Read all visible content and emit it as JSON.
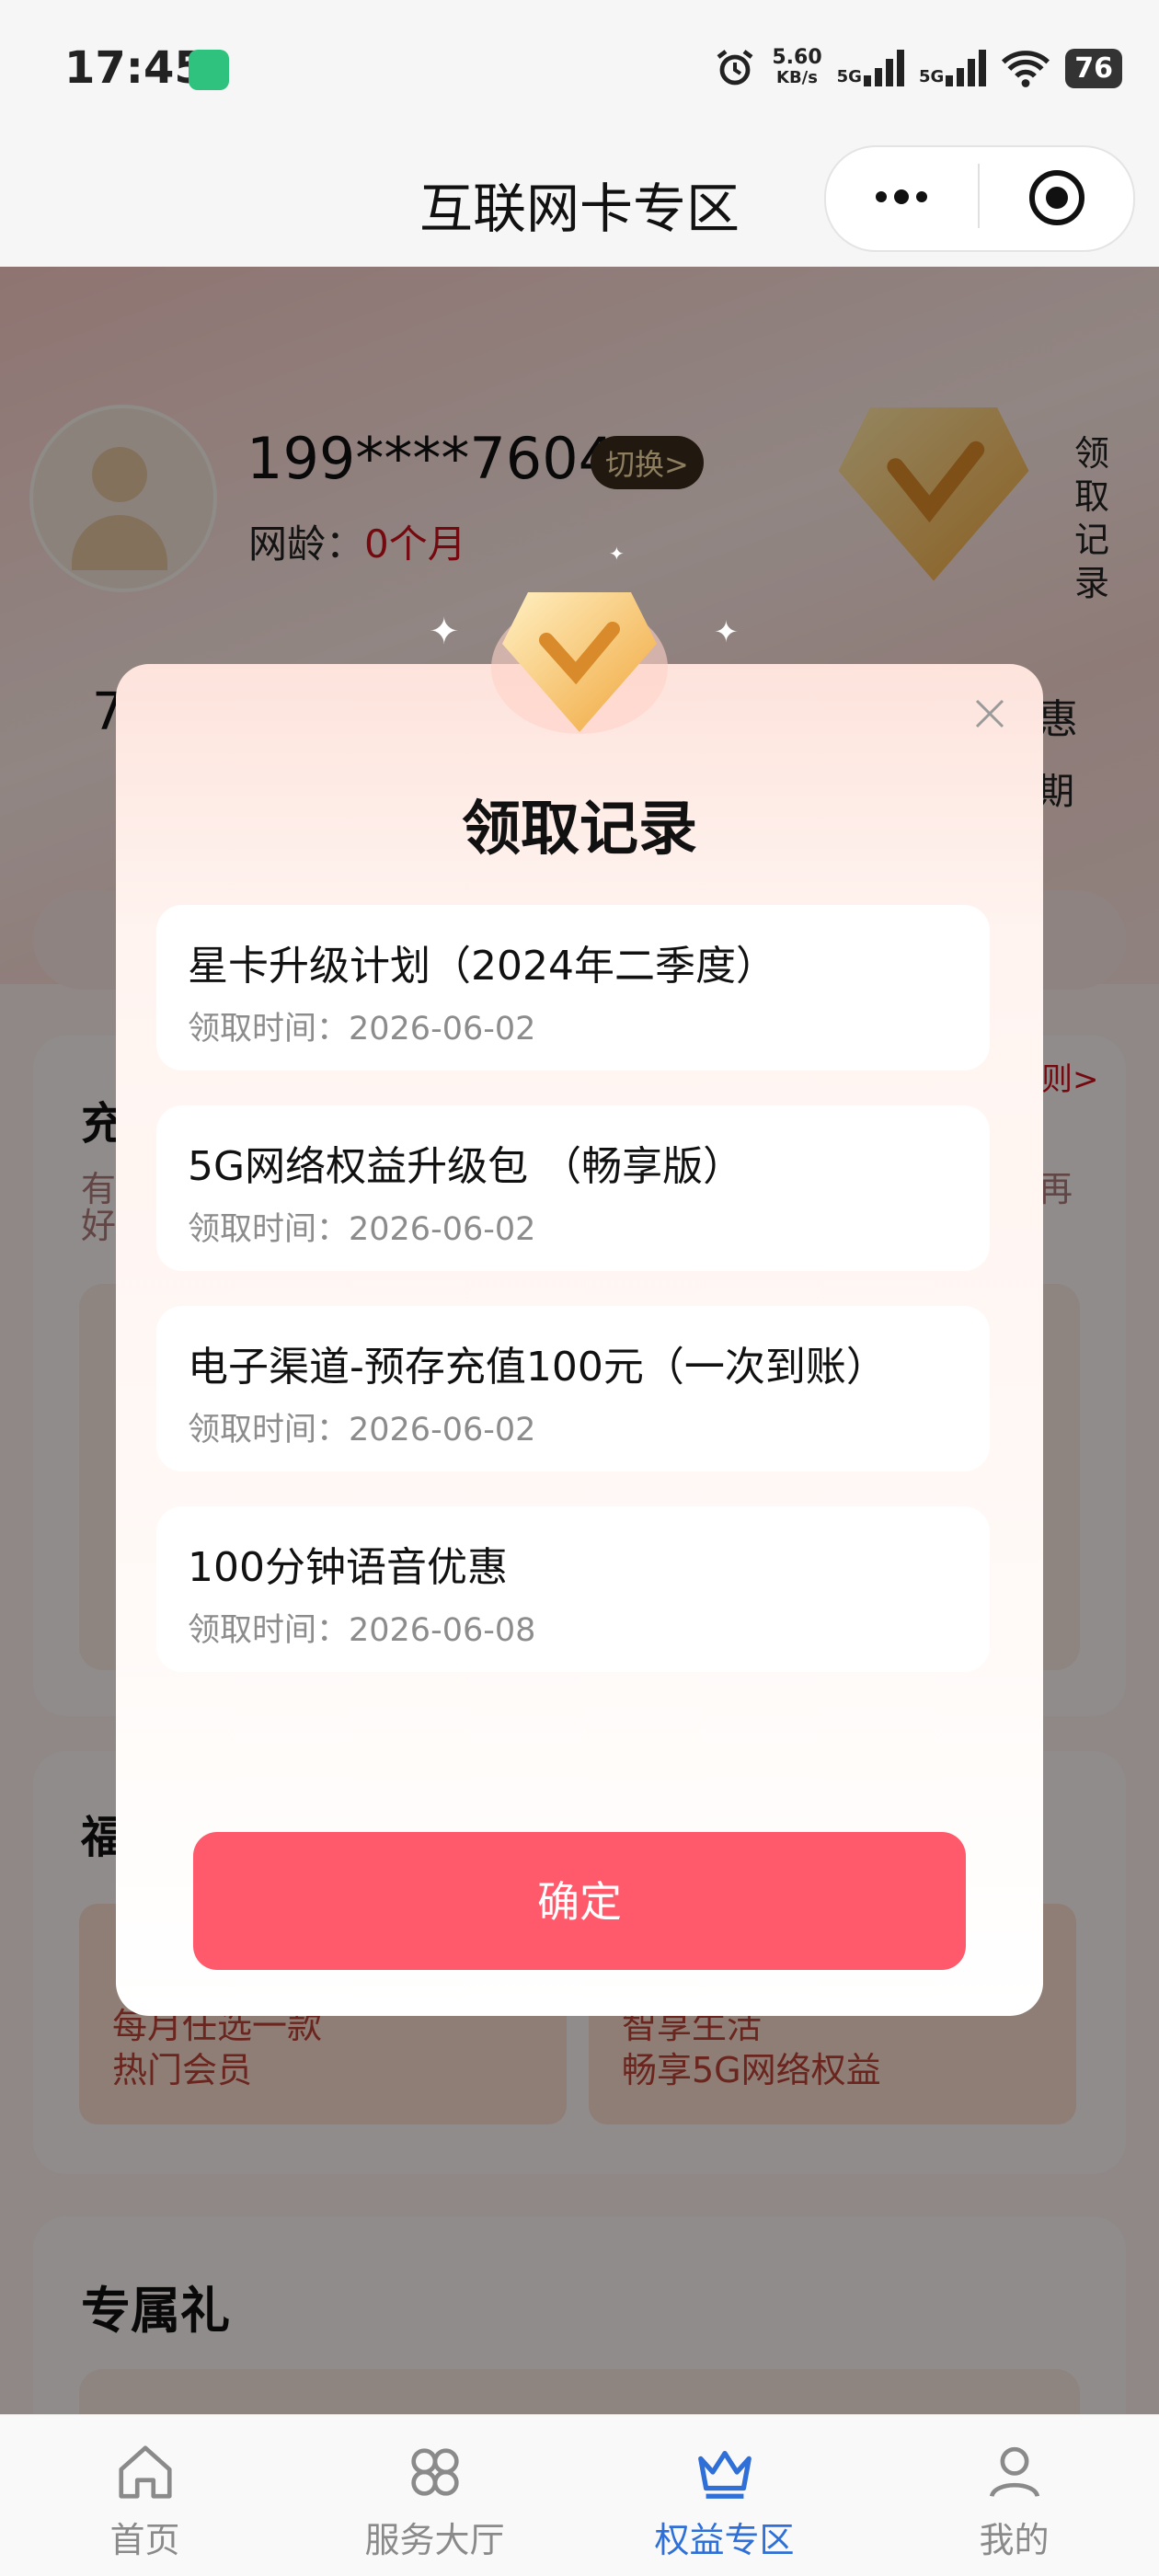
{
  "status_bar": {
    "time": "17:45",
    "net_speed": "5.60",
    "net_unit": "KB/s",
    "signal1": "5G",
    "signal2": "5G",
    "battery": "76"
  },
  "header": {
    "title": "互联网卡专区"
  },
  "profile": {
    "phone": "199****7604",
    "switch_label": "切换>",
    "age_label": "网龄：",
    "age_value": "0个月",
    "records_side": "领取记录"
  },
  "background": {
    "section1_title": "充",
    "rules_link": "则>",
    "section2_title": "福",
    "card1_line1": "每月任选一款",
    "card1_line2": "热门会员",
    "card2_line1": "智享生活",
    "card2_line2": "畅享5G网络权益",
    "section3_title": "专属礼",
    "peek_left": "7",
    "peek_right_top": "惠",
    "peek_right_bottom": "期",
    "small1": "有",
    "small2": "好",
    "small_right": "再"
  },
  "modal": {
    "title": "领取记录",
    "time_prefix": "领取时间：",
    "items": [
      {
        "title": "星卡升级计划（2024年二季度）",
        "time": "领取时间：2026-06-02"
      },
      {
        "title": "5G网络权益升级包 （畅享版）",
        "time": "领取时间：2026-06-02"
      },
      {
        "title": "电子渠道-预存充值100元（一次到账）",
        "time": "领取时间：2026-06-02"
      },
      {
        "title": "100分钟语音优惠",
        "time": "领取时间：2026-06-08"
      }
    ],
    "confirm_label": "确定"
  },
  "tabbar": {
    "tabs": [
      {
        "label": "首页",
        "icon": "home-icon"
      },
      {
        "label": "服务大厅",
        "icon": "grid-icon"
      },
      {
        "label": "权益专区",
        "icon": "crown-icon",
        "active": true
      },
      {
        "label": "我的",
        "icon": "user-icon"
      }
    ]
  },
  "colors": {
    "accent": "#ff5a6b",
    "active_tab": "#2f6fd8",
    "age_value": "#c8101a"
  }
}
